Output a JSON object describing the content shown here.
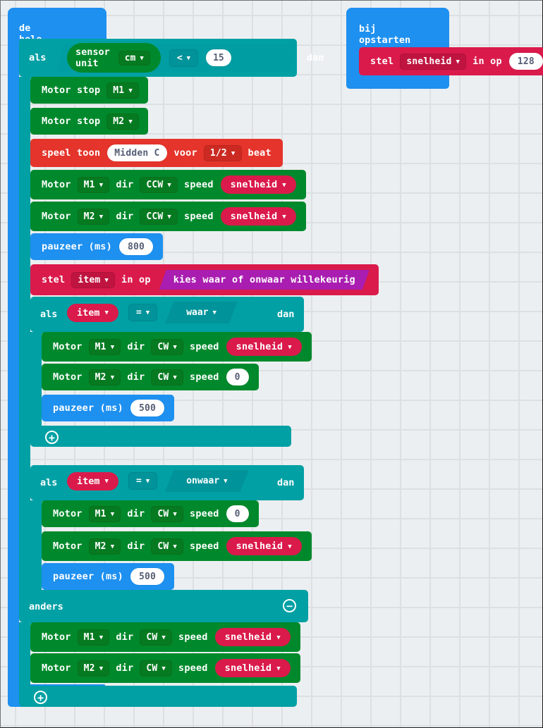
{
  "canvas": {
    "background_color": "#ECEFF1",
    "grid_color": "#DCE0E2"
  },
  "colors": {
    "loops_blue": "#1E90F0",
    "logic_teal": "#00A0A4",
    "motor_green": "#00892C",
    "music_red": "#E4342B",
    "variables_crimson": "#DA1A4B",
    "random_purple": "#A91DB0",
    "field_white": "#FFFFFF",
    "field_text": "#575E75"
  },
  "scripts": [
    {
      "id": "forever-script",
      "hat_label": "de hele tijd"
    },
    {
      "id": "onstart-script",
      "hat_label": "bij opstarten"
    }
  ],
  "onstart": {
    "hat_label": "bij opstarten",
    "set_block": {
      "prefix": "stel",
      "variable": "snelheid",
      "middle": "in op",
      "value": "128"
    }
  },
  "forever": {
    "hat_label": "de hele tijd",
    "if_sensor": {
      "if_label": "als",
      "then_label": "dan",
      "condition": {
        "sensor_block": "sensor unit",
        "sensor_unit": "cm",
        "operator": "<",
        "value": "15"
      },
      "body": [
        {
          "type": "motor-stop",
          "label": "Motor stop",
          "port": "M1"
        },
        {
          "type": "motor-stop",
          "label": "Motor stop",
          "port": "M2"
        },
        {
          "type": "play-tone",
          "prefix": "speel toon",
          "note": "Midden C",
          "middle": "voor",
          "duration": "1/2",
          "suffix": "beat"
        },
        {
          "type": "motor-run",
          "label": "Motor",
          "port": "M1",
          "dir_label": "dir",
          "dir": "CCW",
          "speed_label": "speed",
          "speed_var": "snelheid"
        },
        {
          "type": "motor-run",
          "label": "Motor",
          "port": "M2",
          "dir_label": "dir",
          "dir": "CCW",
          "speed_label": "speed",
          "speed_var": "snelheid"
        },
        {
          "type": "pause",
          "label": "pauzeer (ms)",
          "value": "800"
        },
        {
          "type": "set-var",
          "prefix": "stel",
          "variable": "item",
          "middle": "in op",
          "value_block": "kies waar of onwaar willekeurig"
        }
      ],
      "nested_if_true": {
        "if_label": "als",
        "then_label": "dan",
        "left": "item",
        "operator": "=",
        "right": "waar",
        "body": [
          {
            "type": "motor-run",
            "label": "Motor",
            "port": "M1",
            "dir_label": "dir",
            "dir": "CW",
            "speed_label": "speed",
            "speed_var": "snelheid"
          },
          {
            "type": "motor-run-num",
            "label": "Motor",
            "port": "M2",
            "dir_label": "dir",
            "dir": "CW",
            "speed_label": "speed",
            "speed_value": "0"
          },
          {
            "type": "pause",
            "label": "pauzeer (ms)",
            "value": "500"
          }
        ],
        "add_icon": "plus-icon"
      },
      "nested_if_false": {
        "if_label": "als",
        "then_label": "dan",
        "left": "item",
        "operator": "=",
        "right": "onwaar",
        "body": [
          {
            "type": "motor-run-num",
            "label": "Motor",
            "port": "M1",
            "dir_label": "dir",
            "dir": "CW",
            "speed_label": "speed",
            "speed_value": "0"
          },
          {
            "type": "motor-run",
            "label": "Motor",
            "port": "M2",
            "dir_label": "dir",
            "dir": "CW",
            "speed_label": "speed",
            "speed_var": "snelheid"
          },
          {
            "type": "pause",
            "label": "pauzeer (ms)",
            "value": "500"
          }
        ],
        "add_icon": "plus-icon"
      },
      "else_label": "anders",
      "remove_icon": "minus-icon",
      "else_body": [
        {
          "type": "motor-run",
          "label": "Motor",
          "port": "M1",
          "dir_label": "dir",
          "dir": "CW",
          "speed_label": "speed",
          "speed_var": "snelheid"
        },
        {
          "type": "motor-run",
          "label": "Motor",
          "port": "M2",
          "dir_label": "dir",
          "dir": "CW",
          "speed_label": "speed",
          "speed_var": "snelheid"
        }
      ],
      "add_icon": "plus-icon"
    }
  }
}
